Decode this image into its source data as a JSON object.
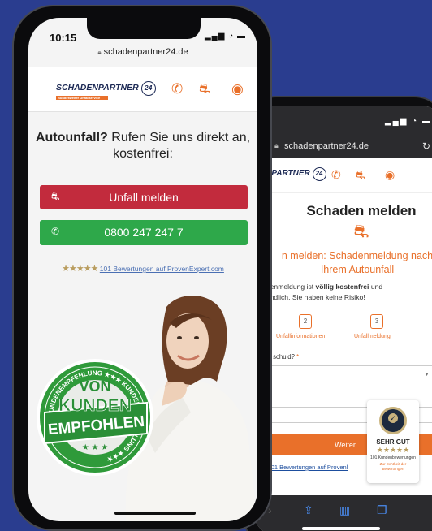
{
  "back_phone": {
    "url": "schadenpartner24.de",
    "logo_text": "ADENPARTNER",
    "logo_number": "24",
    "title": "Schaden melden",
    "subtitle_line1": "n melden: Schadenmeldung nach",
    "subtitle_line2": "Ihrem Autounfall",
    "text_line1_pre": "chadenmeldung ist ",
    "text_line1_bold": "völlig kostenfrei",
    "text_line1_post": " und",
    "text_line2": "verbindlich. Sie haben keine Risiko!",
    "steps": [
      {
        "num": "2",
        "label": "Unfallinformationen"
      },
      {
        "num": "3",
        "label": "Unfallmeldung"
      }
    ],
    "question": "Unfall schuld?",
    "required_mark": "*",
    "weiter": "Weiter",
    "rating_stars": "★★",
    "rating_link": "101 Bewertungen auf Provenl"
  },
  "badge": {
    "verdict": "SEHR GUT",
    "stars": "★★★★★",
    "count": "101 Kundenbewertungen",
    "echtheit_line1": "Zur Echtheit der",
    "echtheit_line2": "Bewertungen"
  },
  "front_phone": {
    "time": "10:15",
    "url": "schadenpartner24.de",
    "logo_text": "SCHADENPARTNER",
    "logo_number": "24",
    "logo_tagline": "Bundesweiter Unfallservice",
    "headline_bold": "Autounfall?",
    "headline_rest": " Rufen Sie uns direkt an,",
    "headline_line2": "kostenfrei:",
    "btn_report": "Unfall melden",
    "btn_phone": "0800 247 247 7",
    "rating_stars": "★★★★★",
    "rating_link": "101 Bewertungen auf ProvenExpert.com",
    "seal_line1": "VON",
    "seal_line2": "KUNDEN",
    "seal_line3": "EMPFOHLEN",
    "seal_ring": "KUNDENEMPFEHLUNG ★★★ KUNDENEMPFEHLUNG ★★★"
  },
  "colors": {
    "background": "#2a3d8f",
    "accent_orange": "#e9702a",
    "report_red": "#c22b3d",
    "call_green": "#2ea84a",
    "seal_green": "#2f9a3a",
    "stars_gold": "#b99d5f"
  }
}
